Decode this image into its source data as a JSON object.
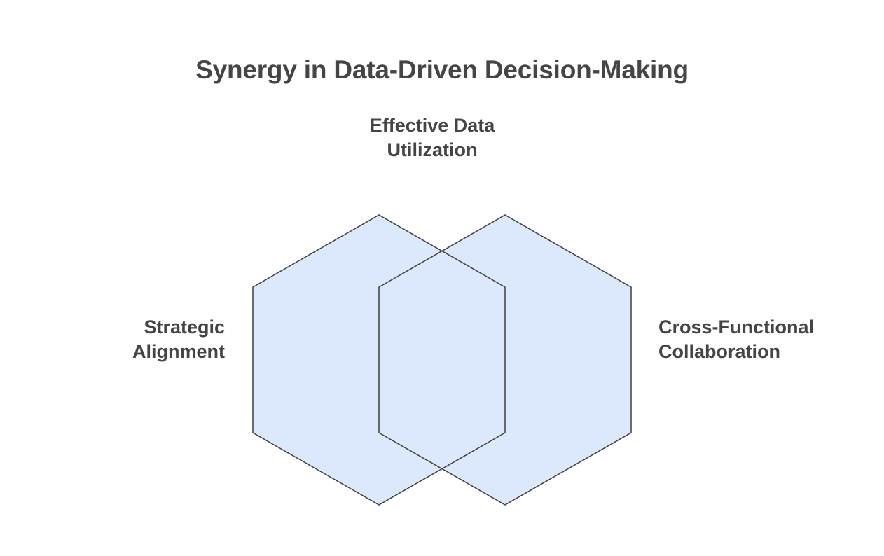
{
  "title": "Synergy in Data-Driven Decision-Making",
  "labels": {
    "top": [
      "Effective Data",
      "Utilization"
    ],
    "left": [
      "Strategic",
      "Alignment"
    ],
    "right": [
      "Cross-Functional",
      "Collaboration"
    ]
  },
  "colors": {
    "hexagon_fill": "#dce8fc",
    "hexagon_stroke": "#3f3f3f",
    "text": "#454545"
  }
}
